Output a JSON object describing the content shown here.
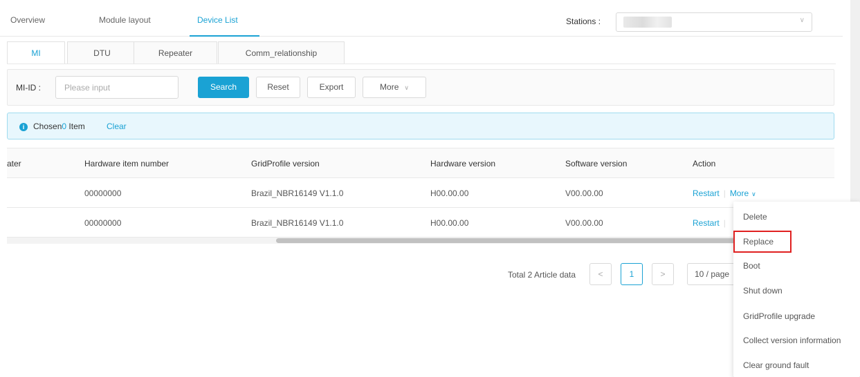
{
  "nav": {
    "tabs": [
      "Overview",
      "Module layout",
      "Device List"
    ],
    "active": "Device List",
    "stations_label": "Stations :"
  },
  "subtabs": [
    "MI",
    "DTU",
    "Repeater",
    "Comm_relationship"
  ],
  "filter": {
    "label": "MI-ID :",
    "placeholder": "Please input",
    "search": "Search",
    "reset": "Reset",
    "export": "Export",
    "more": "More"
  },
  "alert": {
    "chosen_prefix": "Chosen",
    "chosen_count": "0",
    "chosen_suffix": " Item",
    "clear": "Clear"
  },
  "table": {
    "headers": [
      "ater",
      "Hardware item number",
      "GridProfile version",
      "Hardware version",
      "Software version",
      "Action"
    ],
    "rows": [
      {
        "hw_item": "00000000",
        "grid": "Brazil_NBR16149 V1.1.0",
        "hw_ver": "H00.00.00",
        "sw_ver": "V00.00.00"
      },
      {
        "hw_item": "00000000",
        "grid": "Brazil_NBR16149 V1.1.0",
        "hw_ver": "H00.00.00",
        "sw_ver": "V00.00.00"
      }
    ],
    "action_restart": "Restart",
    "action_more": "More"
  },
  "pager": {
    "total": "Total 2 Article data",
    "prev": "<",
    "page": "1",
    "next": ">",
    "size": "10 / page"
  },
  "dropdown": {
    "items": [
      "Delete",
      "Replace",
      "Boot",
      "Shut down",
      "GridProfile upgrade",
      "Collect version information",
      "Clear ground fault"
    ],
    "highlighted": "Replace",
    "highlight_color": "#e02020"
  },
  "colors": {
    "accent": "#1aa2d4"
  }
}
